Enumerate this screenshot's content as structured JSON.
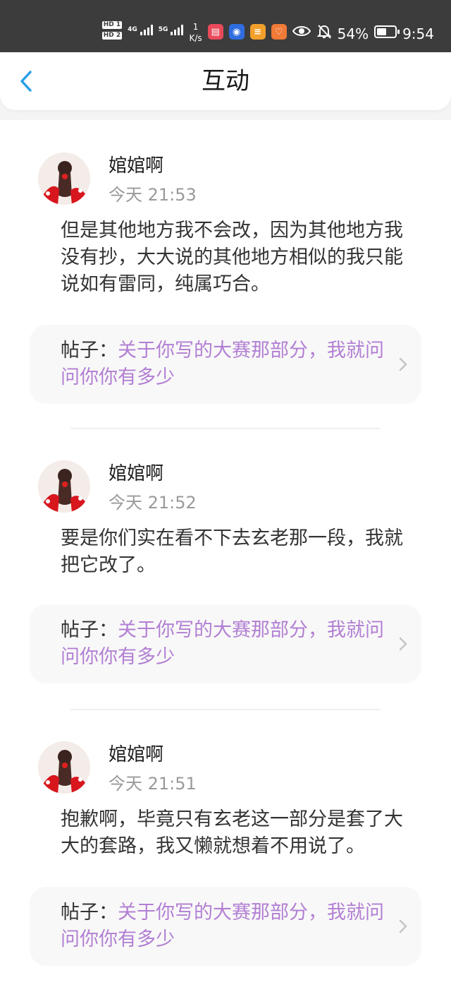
{
  "status_bar": {
    "hd1": "HD 1",
    "hd2": "HD 2",
    "net1": "4G",
    "net2": "5G",
    "speed_value": "1",
    "speed_unit": "K/s",
    "battery_percent": "54%",
    "battery_level": 0.54,
    "time": "9:54"
  },
  "header": {
    "title": "互动"
  },
  "comments": [
    {
      "username": "婠婠啊",
      "time": "今天 21:53",
      "text": "但是其他地方我不会改，因为其他地方我没有抄，大大说的其他地方相似的我只能说如有雷同，纯属巧合。",
      "post_prefix": "帖子：",
      "post_title": "关于你写的大赛那部分，我就问问你你有多少"
    },
    {
      "username": "婠婠啊",
      "time": "今天 21:52",
      "text": "要是你们实在看不下去玄老那一段，我就把它改了。",
      "post_prefix": "帖子：",
      "post_title": "关于你写的大赛那部分，我就问问你你有多少"
    },
    {
      "username": "婠婠啊",
      "time": "今天 21:51",
      "text": "抱歉啊，毕竟只有玄老这一部分是套了大大的套路，我又懒就想着不用说了。",
      "post_prefix": "帖子：",
      "post_title": "关于你写的大赛那部分，我就问问你你有多少"
    }
  ],
  "colors": {
    "accent": "#2aa0e8",
    "post_title": "#b27fd3",
    "status_bar_bg": "#3c3c3c"
  }
}
